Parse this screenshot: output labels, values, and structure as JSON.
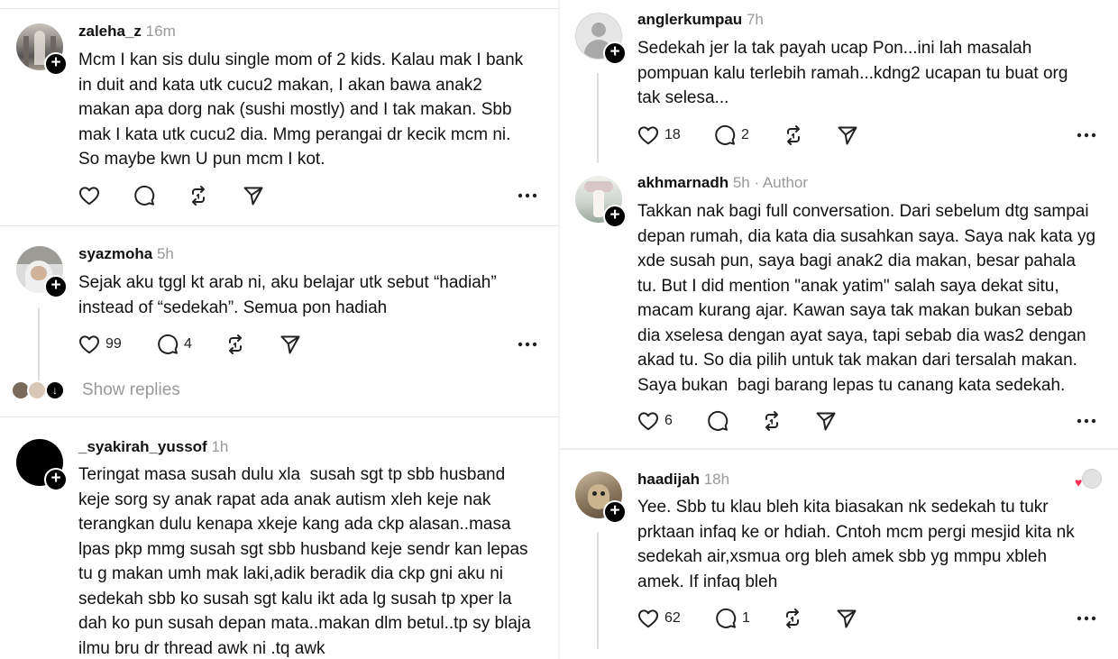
{
  "left": {
    "posts": [
      {
        "username": "zaleha_z",
        "time": "16m",
        "text": "Mcm I kan sis dulu single mom of 2 kids. Kalau mak I bank\nin duit and kata utk cucu2 makan, I akan bawa anak2\nmakan apa dorg nak (sushi mostly) and I tak makan. Sbb\nmak I kata utk cucu2 dia. Mmg perangai dr kecik mcm ni.\nSo maybe kwn U pun mcm I kot.",
        "likes": "",
        "replies": ""
      },
      {
        "username": "syazmoha",
        "time": "5h",
        "text": "Sejak aku tggl kt arab ni, aku belajar utk sebut “hadiah”\ninstead of “sedekah”. Semua pon hadiah",
        "likes": "99",
        "replies": "4",
        "show_replies": "Show replies"
      },
      {
        "username": "_syakirah_yussof",
        "time": "1h",
        "text": "Teringat masa susah dulu xla  susah sgt tp sbb husband\nkeje sorg sy anak rapat ada anak autism xleh keje nak\nterangkan dulu kenapa xkeje kang ada ckp alasan..masa\nlpas pkp mmg susah sgt sbb husband keje sendr kan lepas\ntu g makan umh mak laki,adik beradik dia ckp gni aku ni\nsedekah sbb ko susah sgt kalu ikt ada lg susah tp xper la\ndah ko pun susah depan mata..makan dlm betul..tp sy blaja\nilmu bru dr thread awk ni .tq awk"
      }
    ]
  },
  "right": {
    "posts": [
      {
        "username": "anglerkumpau",
        "time": "7h",
        "text": "Sedekah jer la tak payah ucap Pon...ini lah masalah\npompuan kalu terlebih ramah...kdng2 ucapan tu buat org\ntak selesa...",
        "likes": "18",
        "replies": "2"
      },
      {
        "username": "akhmarnadh",
        "time": "5h",
        "author_label": "· Author",
        "text": "Takkan nak bagi full conversation. Dari sebelum dtg sampai\ndepan rumah, dia kata dia susahkan saya. Saya nak kata yg\nxde susah pun, saya bagi anak2 dia makan, besar pahala\ntu. But I did mention \"anak yatim\" salah saya dekat situ,\nmacam kurang ajar. Kawan saya tak makan bukan sebab\ndia xselesa dengan ayat saya, tapi sebab dia was2 dengan\nakad tu. So dia pilih untuk tak makan dari tersalah makan.\nSaya bukan  bagi barang lepas tu canang kata sedekah.",
        "likes": "6",
        "replies": ""
      },
      {
        "username": "haadijah",
        "time": "18h",
        "text": "Yee. Sbb tu klau bleh kita biasakan nk sedekah tu tukr\nprktaan infaq ke or hdiah. Cntoh mcm pergi mesjid kita nk\nsedekah air,xsmua org bleh amek sbb yg mmpu xbleh\namek. If infaq bleh",
        "likes": "62",
        "replies": "1"
      }
    ]
  },
  "icons": {
    "like": "heart-icon",
    "reply": "comment-icon",
    "repost": "repost-icon",
    "share": "send-icon",
    "more": "more-icon",
    "follow": "plus-icon"
  },
  "colors": {
    "text": "#111111",
    "muted": "#999999",
    "divider": "#e6e6e6",
    "liked": "#ff2e55"
  }
}
